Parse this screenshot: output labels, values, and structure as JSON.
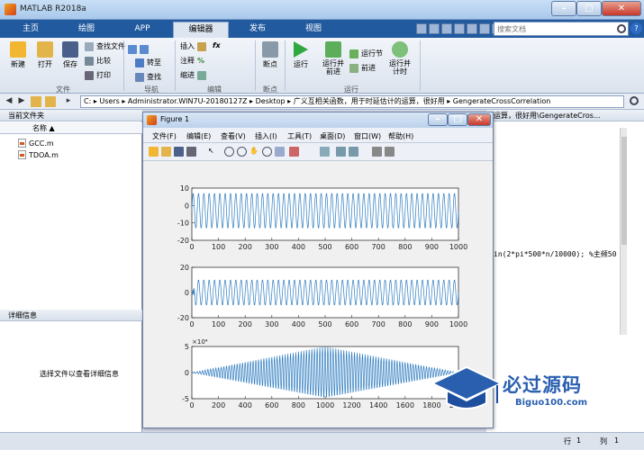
{
  "window": {
    "title": "MATLAB R2018a"
  },
  "tabs": [
    {
      "label": "主页",
      "active": false
    },
    {
      "label": "绘图",
      "active": false
    },
    {
      "label": "APP",
      "active": false
    },
    {
      "label": "编辑器",
      "active": true
    },
    {
      "label": "发布",
      "active": false
    },
    {
      "label": "视图",
      "active": false
    }
  ],
  "search": {
    "placeholder": "搜索文档"
  },
  "ribbon": {
    "file": {
      "new": "新建",
      "open": "打开",
      "save": "保存",
      "find_files": "查找文件",
      "compare": "比较",
      "print": "打印",
      "group": "文件"
    },
    "nav": {
      "goto": "转至",
      "find": "查找",
      "group": "导航"
    },
    "edit": {
      "insert": "插入",
      "comment": "注释",
      "indent": "缩进",
      "fx": "fx",
      "group": "编辑"
    },
    "breakpoints": {
      "label": "断点",
      "group": "断点"
    },
    "run": {
      "run": "运行",
      "run_advance": "运行并\n前进",
      "run_section": "运行节",
      "advance": "前进",
      "run_time": "运行并\n计时",
      "group": "运行"
    }
  },
  "address": {
    "path": "C: ▸ Users ▸ Administrator.WIN7U-20180127Z ▸ Desktop ▸ 广义互相关函数，用于时延估计的运算，很好用 ▸ GengerateCrossCorrelation"
  },
  "left": {
    "current_folder": "当前文件夹",
    "name_col": "名称 ▲",
    "files": [
      "GCC.m",
      "TDOA.m"
    ],
    "details": "详细信息",
    "details_hint": "选择文件以查看详细信息"
  },
  "editor": {
    "tab": "的运算，很好用\\GengerateCros...",
    "code_line": "in(2*pi*500*n/10000); %主频50"
  },
  "status": {
    "row": "行",
    "row_val": "1",
    "col": "列",
    "col_val": "1"
  },
  "figure": {
    "title": "Figure 1",
    "menu": [
      "文件(F)",
      "编辑(E)",
      "查看(V)",
      "插入(I)",
      "工具(T)",
      "桌面(D)",
      "窗口(W)",
      "帮助(H)"
    ],
    "plots": [
      {
        "yticks": [
          "10",
          "0",
          "-10",
          "-20"
        ],
        "xticks": [
          "0",
          "100",
          "200",
          "300",
          "400",
          "500",
          "600",
          "700",
          "800",
          "900",
          "1000"
        ]
      },
      {
        "yticks": [
          "20",
          "0",
          "-20"
        ],
        "xticks": [
          "0",
          "100",
          "200",
          "300",
          "400",
          "500",
          "600",
          "700",
          "800",
          "900",
          "1000"
        ]
      },
      {
        "yticks": [
          "5",
          "0",
          "-5"
        ],
        "xticks": [
          "0",
          "200",
          "400",
          "600",
          "800",
          "1000",
          "1200",
          "1400",
          "1600",
          "1800",
          "2000"
        ],
        "exponent": "×10⁴"
      }
    ]
  },
  "chart_data": [
    {
      "type": "line",
      "x_range": [
        0,
        1000
      ],
      "ylim": [
        -20,
        10
      ],
      "series": [
        {
          "values": "sinusoid, amplitude ≈ 10, ≈ 50 cycles over 1000 samples"
        }
      ],
      "color": "#2e7cc0"
    },
    {
      "type": "line",
      "x_range": [
        0,
        1000
      ],
      "ylim": [
        -20,
        20
      ],
      "series": [
        {
          "values": "sinusoid, amplitude ≈ 10, ≈ 50 cycles, brief transient near x≈0"
        }
      ],
      "color": "#2e7cc0"
    },
    {
      "type": "line",
      "x_range": [
        0,
        2000
      ],
      "ylim": [
        -5,
        5
      ],
      "y_scale_exponent": 4,
      "series": [
        {
          "values": "cross-correlation: oscillation with triangular envelope, peak ≈ ±5×10⁴ at x≈1000"
        }
      ],
      "color": "#2e7cc0"
    }
  ],
  "watermark": {
    "main": "必过源码",
    "sub": "Biguo100.com"
  },
  "colors": {
    "accent": "#215a9e",
    "line": "#2e7cc0"
  }
}
